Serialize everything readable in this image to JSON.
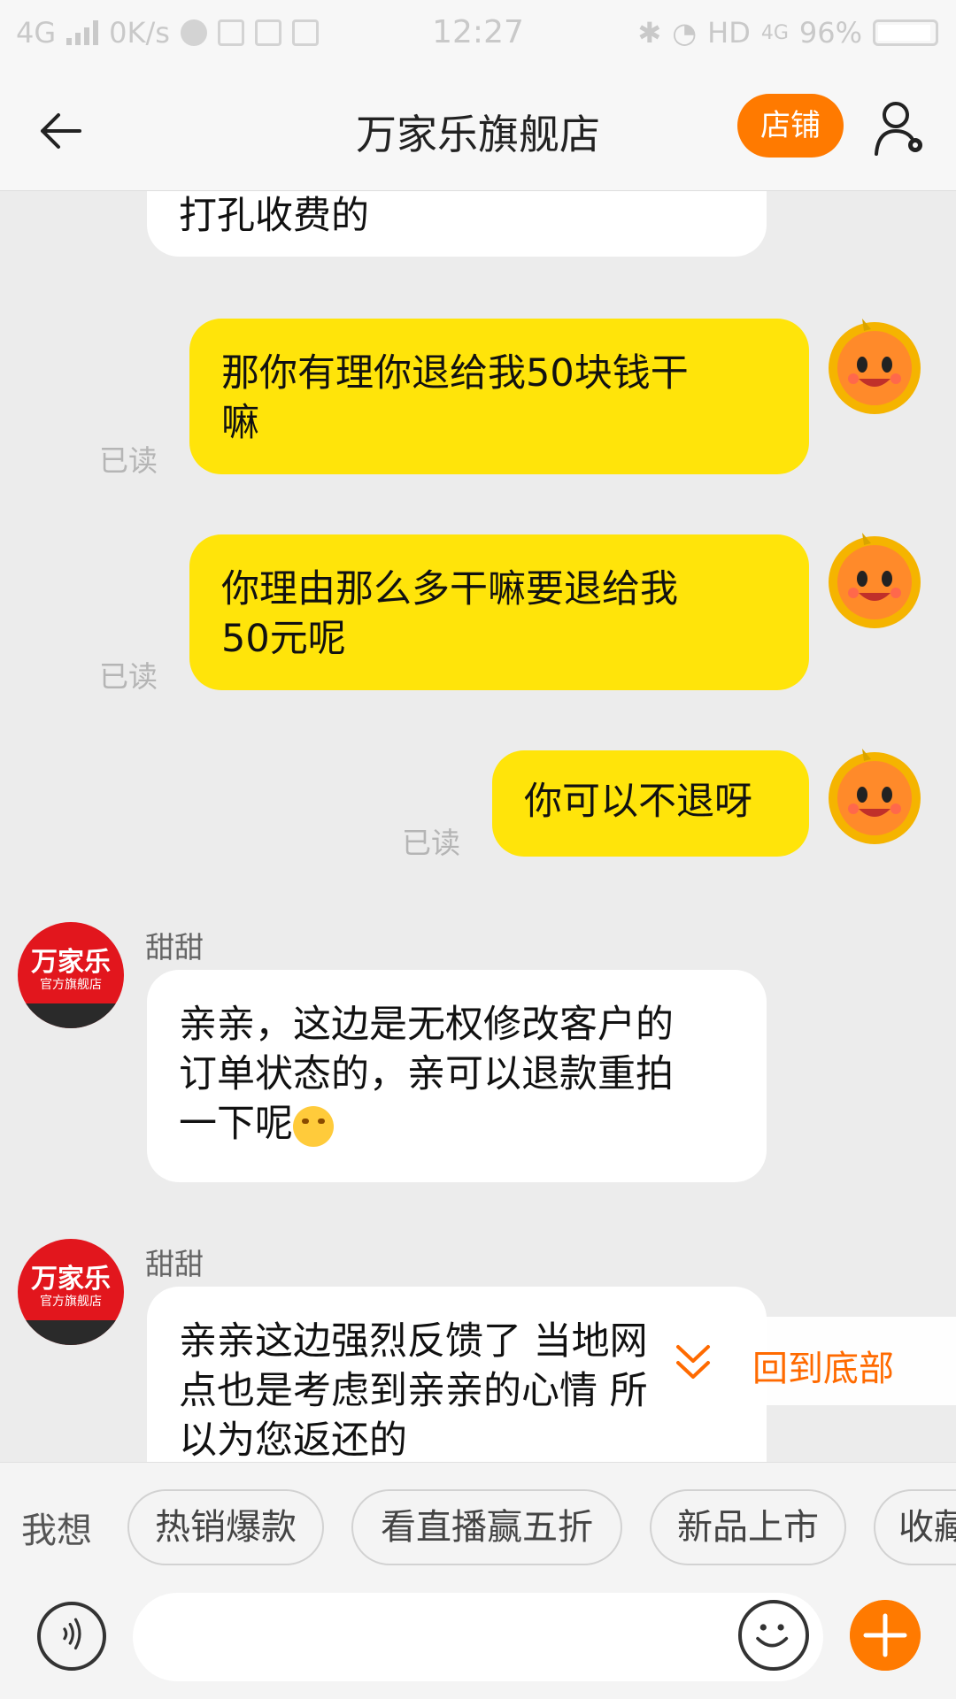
{
  "status_bar": {
    "network": "4G",
    "speed": "0K/s",
    "time": "12:27",
    "hd": "HD",
    "network_right": "4G",
    "battery": "96%"
  },
  "header": {
    "title": "万家乐旗舰店",
    "shop_button": "店铺"
  },
  "messages": [
    {
      "from": "shop",
      "text": "打孔收费的"
    },
    {
      "from": "me",
      "line1": "那你有理你退给我50块钱干",
      "line2": "嘛",
      "read": "已读"
    },
    {
      "from": "me",
      "line1": "你理由那么多干嘛要退给我",
      "line2": "50元呢",
      "read": "已读"
    },
    {
      "from": "me",
      "line1": "你可以不退呀",
      "read": "已读"
    },
    {
      "from": "shop",
      "sender": "甜甜",
      "line1": "亲亲，这边是无权修改客户的",
      "line2": "订单状态的，亲可以退款重拍",
      "line3": "一下呢"
    },
    {
      "from": "shop",
      "sender": "甜甜",
      "line1": "亲亲这边强烈反馈了 当地网",
      "line2": "点也是考虑到亲亲的心情 所",
      "line3": "以为您返还的"
    }
  ],
  "shop_avatar": {
    "brand": "万家乐",
    "sub": "官方旗舰店"
  },
  "back_to_bottom": "回到底部",
  "quick_phrases": {
    "label": "我想",
    "chips": [
      "热销爆款",
      "看直播赢五折",
      "新品上市",
      "收藏"
    ]
  },
  "input": {
    "placeholder": ""
  },
  "colors": {
    "accent": "#ff7a00",
    "my_bubble": "#ffe40a",
    "their_bubble": "#ffffff",
    "background": "#ececec"
  }
}
